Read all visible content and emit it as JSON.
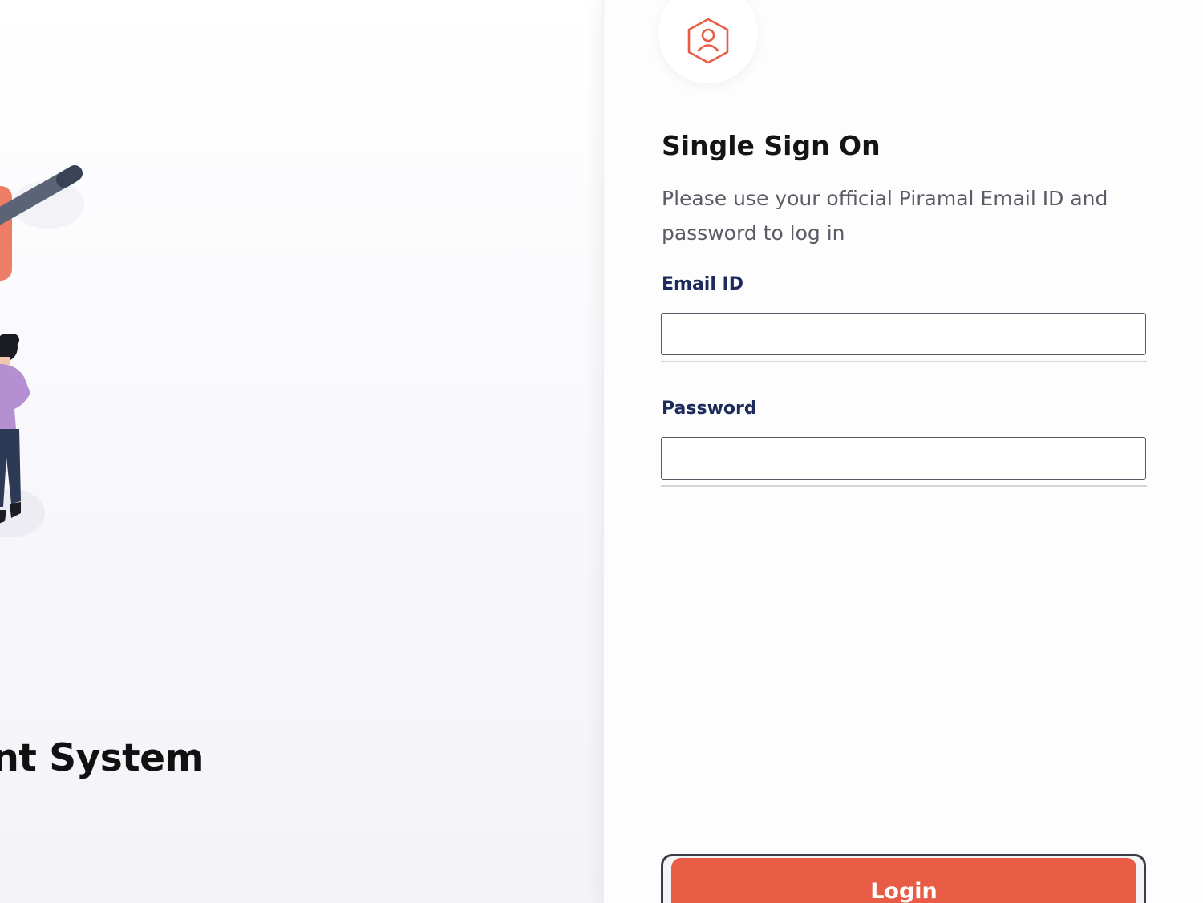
{
  "left_panel": {
    "system_title": "ent System"
  },
  "login_form": {
    "title": "Single Sign On",
    "subtitle": "Please use your official Piramal Email ID and password to log in",
    "email": {
      "label": "Email ID",
      "value": "",
      "placeholder": ""
    },
    "password": {
      "label": "Password",
      "value": "",
      "placeholder": ""
    },
    "login_button_label": "Login"
  },
  "icons": {
    "avatar": "user-hexagon-icon"
  },
  "colors": {
    "accent": "#e85c45",
    "label": "#1c2a5c",
    "title": "#141414",
    "subtitle": "#5c5c66"
  }
}
